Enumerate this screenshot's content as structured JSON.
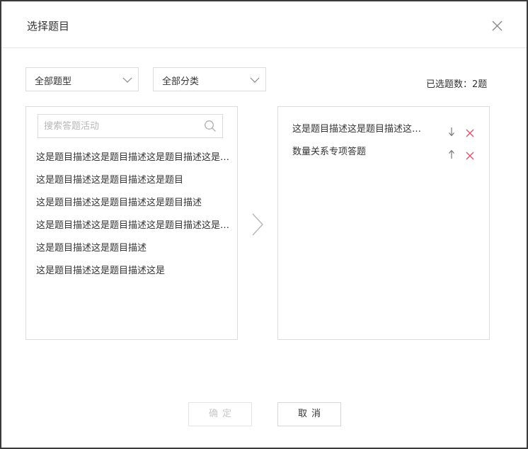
{
  "dialog": {
    "title": "选择题目"
  },
  "filters": {
    "type_select": "全部题型",
    "category_select": "全部分类"
  },
  "selected_count": "已选题数：2题",
  "search": {
    "placeholder": "搜索答题活动"
  },
  "question_list": [
    "这是题目描述这是题目描述这是题目描述这是题目描述这是题目描述",
    "这是题目描述这是题目描述这是题目",
    "这是题目描述这是题目描述这是题目描述",
    "这是题目描述这是题目描述这是题目描述这是题目描述这是题目描述",
    "这是题目描述这是题目描述",
    "这是题目描述这是题目描述这是"
  ],
  "selected_list": [
    {
      "label": "这是题目描述这是题目描述这是题目描述",
      "move_icon": "arrow-down-icon"
    },
    {
      "label": "数量关系专项答题",
      "move_icon": "arrow-up-icon"
    }
  ],
  "buttons": {
    "confirm": "确定",
    "cancel": "取消"
  },
  "colors": {
    "delete_icon": "#d9506a",
    "border": "#dcdcdc",
    "text": "#333333"
  }
}
